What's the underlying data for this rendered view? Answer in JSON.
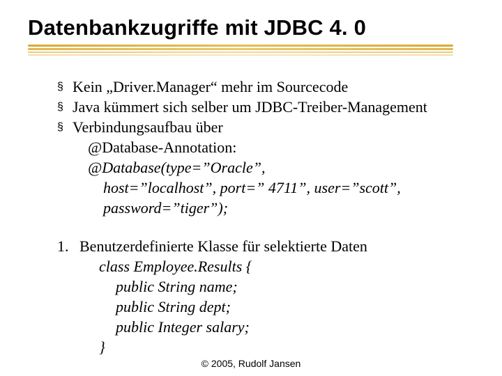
{
  "title": "Datenbankzugriffe mit JDBC 4. 0",
  "bullets": [
    {
      "text": "Kein „Driver.Manager“ mehr im Sourcecode"
    },
    {
      "text": "Java kümmert sich selber um JDBC-Treiber-Management"
    },
    {
      "text": "Verbindungsaufbau über",
      "sub": [
        "@Database-Annotation:",
        "@Database(type=”Oracle”,",
        "host=”localhost”, port=” 4711”, user=”scott”,",
        "password=”tiger”);"
      ],
      "sub_italic_from": 1
    }
  ],
  "numbered": [
    {
      "num": "1.",
      "text": "Benutzerdefinierte Klasse für selektierte Daten",
      "code": [
        "class Employee.Results {",
        "  public String name;",
        "  public String dept;",
        "  public Integer salary;",
        "}"
      ]
    }
  ],
  "footer": "© 2005, Rudolf Jansen"
}
